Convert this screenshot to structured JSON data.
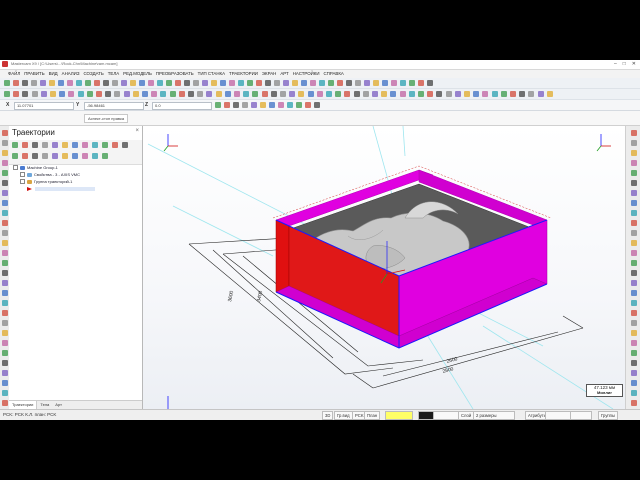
{
  "window": {
    "title": "Mastercam X9 / [C:\\Users\\...\\Rock-Chn\\Machine\\ram.mcam]",
    "controls": [
      "–",
      "□",
      "✕"
    ]
  },
  "menu": [
    "ФАЙЛ",
    "ПРАВИТЬ",
    "ВИД",
    "АНАЛИЗ",
    "СОЗДАТЬ",
    "ТЕЛА",
    "РЕД.МОДЕЛЬ",
    "ПРЕОБРАЗОВАТЬ",
    "ТИП СТАНКА",
    "ТРАЕКТОРИИ",
    "ЭКРАН",
    "АРТ",
    "НАСТРОЙКИ",
    "СПРАВКА"
  ],
  "coords": {
    "x_label": "X",
    "x_value": "11.07701",
    "y_label": "Y",
    "y_value": "-56.98461",
    "z_label": "Z",
    "z_value": "0.0"
  },
  "tooltip": "Аспект-стоп правка",
  "panel": {
    "title": "Траектории",
    "close": "×",
    "tree": [
      {
        "label": "Machine Group-1",
        "indent": 0
      },
      {
        "label": "Свойства - 3 - AXIS VMC",
        "indent": 1
      },
      {
        "label": "Группа траекторий-1",
        "indent": 1
      }
    ],
    "tabs": [
      "Траектории",
      "Тела",
      "Арт"
    ]
  },
  "viewport": {
    "dim_front": "2800",
    "dim_front_inner": "2600",
    "dim_left": "3600",
    "dim_left_inner": "3400",
    "scale_value": "47.123 мм",
    "scale_unit": "Миллиг"
  },
  "status": {
    "left": "PCK: PCK  К.Л. план: PCK",
    "cells": [
      "3D",
      "Гр.вид",
      "PCK",
      "План",
      "",
      "",
      "Слой",
      "2  размеры",
      "",
      "Атрибуты",
      "",
      "",
      "",
      "Группы"
    ]
  },
  "colors": {
    "magenta": "#e000e0",
    "red": "#e01010",
    "blue": "#1a1aff",
    "relief": "#c8c8c8",
    "cyan": "#9fe6ef"
  }
}
